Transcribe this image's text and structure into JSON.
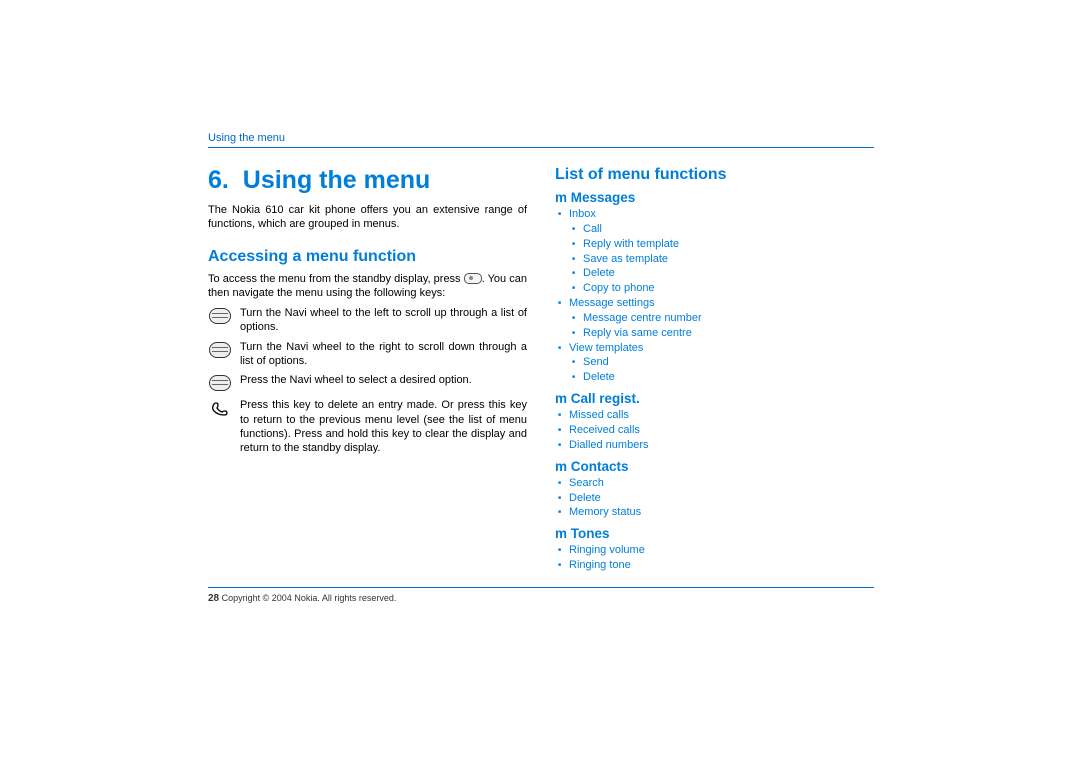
{
  "running_head": "Using the menu",
  "chapter_num": "6.",
  "chapter_title": "Using the menu",
  "intro": "The Nokia 610 car kit phone offers you an extensive range of functions, which are grouped in menus.",
  "section_access": "Accessing a menu function",
  "access_para_before": "To access the menu from the standby display, press ",
  "access_para_after": ". You can then navigate the menu using the following keys:",
  "instr1": "Turn the Navi wheel to the left to scroll up through a list of options.",
  "instr2": "Turn the Navi wheel to the right to scroll down through a list of options.",
  "instr3": "Press the Navi wheel to select a desired option.",
  "instr4": "Press this key to delete an entry made. Or press this key to return to the previous menu level (see the list of menu functions). Press and hold this key to clear the display and return to the standby display.",
  "section_list": "List of menu functions",
  "menus": [
    {
      "title": "m Messages",
      "items": [
        {
          "label": "Inbox",
          "children": [
            "Call",
            "Reply with template",
            "Save as template",
            "Delete",
            "Copy to phone"
          ]
        },
        {
          "label": "Message settings",
          "children": [
            "Message centre number",
            "Reply via same centre"
          ]
        },
        {
          "label": "View templates",
          "children": [
            "Send",
            "Delete"
          ]
        }
      ]
    },
    {
      "title": "m Call regist.",
      "items": [
        {
          "label": "Missed calls"
        },
        {
          "label": "Received calls"
        },
        {
          "label": "Dialled numbers"
        }
      ]
    },
    {
      "title": "m Contacts",
      "items": [
        {
          "label": "Search"
        },
        {
          "label": "Delete"
        },
        {
          "label": "Memory status"
        }
      ]
    },
    {
      "title": "m Tones",
      "items": [
        {
          "label": "Ringing volume"
        },
        {
          "label": "Ringing tone"
        }
      ]
    }
  ],
  "page_number": "28",
  "copyright": "Copyright © 2004 Nokia. All rights reserved."
}
